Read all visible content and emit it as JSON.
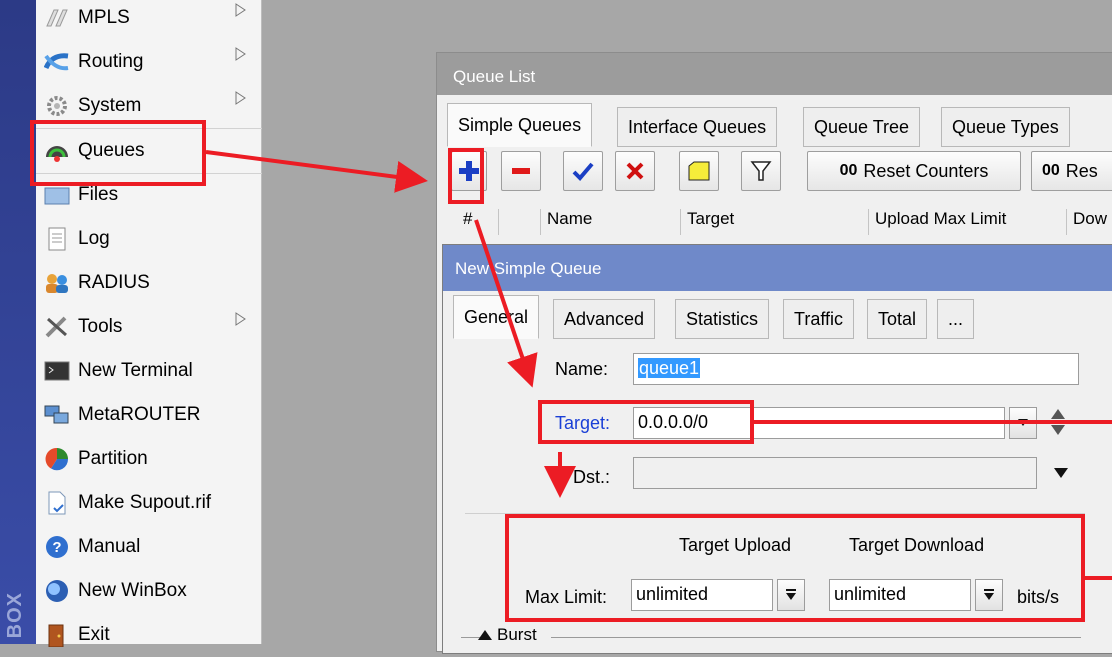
{
  "sidebar": {
    "brand": "BOX",
    "items": [
      {
        "label": "MPLS",
        "icon": "mpls-icon",
        "submenu": true
      },
      {
        "label": "Routing",
        "icon": "routing-icon",
        "submenu": true
      },
      {
        "label": "System",
        "icon": "gear-icon",
        "submenu": true
      },
      {
        "label": "Queues",
        "icon": "queues-icon",
        "submenu": false
      },
      {
        "label": "Files",
        "icon": "folder-icon",
        "submenu": false
      },
      {
        "label": "Log",
        "icon": "log-icon",
        "submenu": false
      },
      {
        "label": "RADIUS",
        "icon": "radius-icon",
        "submenu": false
      },
      {
        "label": "Tools",
        "icon": "tools-icon",
        "submenu": true
      },
      {
        "label": "New Terminal",
        "icon": "terminal-icon",
        "submenu": false
      },
      {
        "label": "MetaROUTER",
        "icon": "metarouter-icon",
        "submenu": false
      },
      {
        "label": "Partition",
        "icon": "partition-icon",
        "submenu": false
      },
      {
        "label": "Make Supout.rif",
        "icon": "document-icon",
        "submenu": false
      },
      {
        "label": "Manual",
        "icon": "help-icon",
        "submenu": false
      },
      {
        "label": "New WinBox",
        "icon": "globe-icon",
        "submenu": false
      },
      {
        "label": "Exit",
        "icon": "exit-icon",
        "submenu": false
      }
    ]
  },
  "queue_list": {
    "title": "Queue List",
    "tabs": [
      "Simple Queues",
      "Interface Queues",
      "Queue Tree",
      "Queue Types"
    ],
    "toolbar": {
      "reset_counters": "Reset Counters",
      "reset_all_partial": "Res",
      "counter_glyph": "00"
    },
    "columns": [
      "#",
      "",
      "Name",
      "Target",
      "Upload Max Limit",
      "Dow"
    ]
  },
  "new_simple_queue": {
    "title": "New Simple Queue",
    "tabs": [
      "General",
      "Advanced",
      "Statistics",
      "Traffic",
      "Total",
      "..."
    ],
    "name_label": "Name:",
    "name_value": "queue1",
    "target_label": "Target:",
    "target_value": "0.0.0.0/0",
    "dst_label": "Dst.:",
    "dst_value": "",
    "target_upload_header": "Target Upload",
    "target_download_header": "Target Download",
    "max_limit_label": "Max Limit:",
    "upload_max_limit": "unlimited",
    "download_max_limit": "unlimited",
    "unit": "bits/s",
    "burst_label": "Burst"
  },
  "colors": {
    "annotation_red": "#ec1c24",
    "selection_blue": "#3399ff",
    "link_blue": "#1a3fd6",
    "titlebar_active": "#6f89c9"
  }
}
